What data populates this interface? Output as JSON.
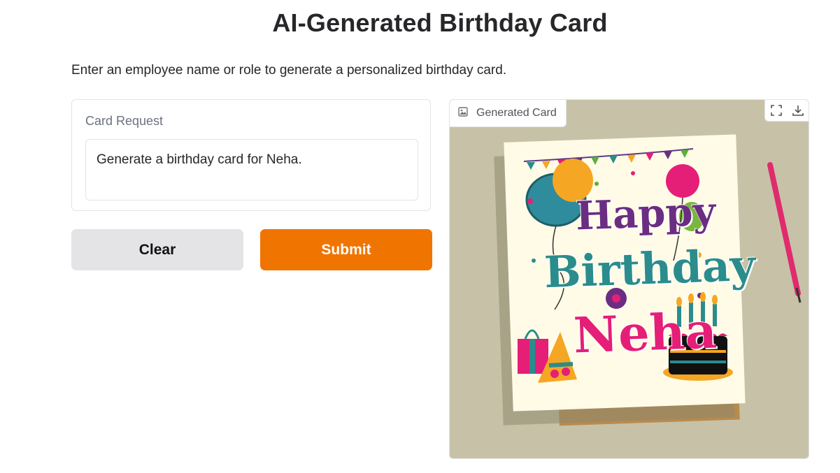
{
  "page": {
    "title": "AI-Generated Birthday Card",
    "description": "Enter an employee name or role to generate a personalized birthday card."
  },
  "input": {
    "label": "Card Request",
    "value": "Generate a birthday card for Neha."
  },
  "buttons": {
    "clear": "Clear",
    "submit": "Submit"
  },
  "output": {
    "label": "Generated Card",
    "label_icon": "image-icon",
    "tools": [
      "fullscreen-icon",
      "download-icon"
    ],
    "card_text": {
      "line1": "Happy",
      "line2": "Birthday",
      "line3": "Neha"
    }
  },
  "colors": {
    "submit": "#f07400",
    "clear": "#e4e4e7",
    "image_background": "#c7c2a7"
  }
}
